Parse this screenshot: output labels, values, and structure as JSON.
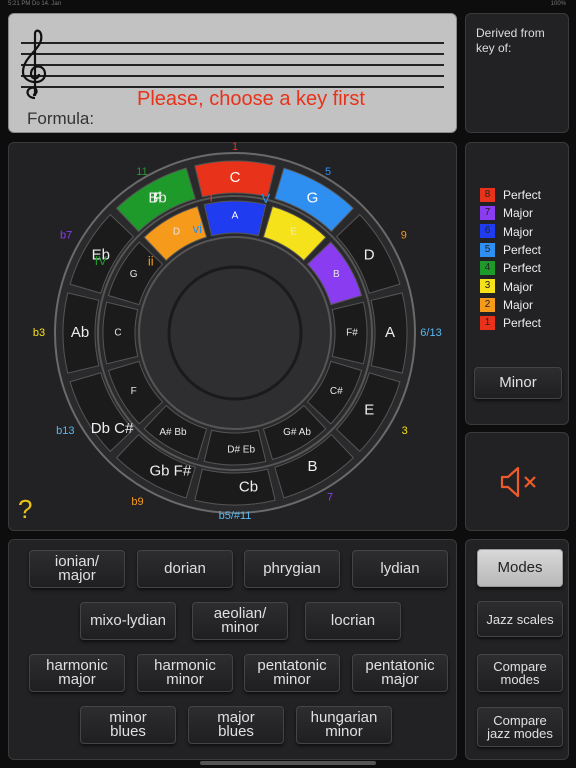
{
  "status": {
    "time": "5:21 PM  Do 14. Jan",
    "battery": "100%"
  },
  "staff": {
    "formula_label": "Formula:",
    "prompt": "Please, choose a key first"
  },
  "derived": {
    "label": "Derived from key of:"
  },
  "wheel": {
    "outer_keys": [
      "C",
      "G",
      "D",
      "A",
      "E",
      "B",
      "Cb",
      "Gb F#",
      "Db C#",
      "Ab",
      "Eb",
      "Bb",
      "F"
    ],
    "inner_keys": [
      "A",
      "E",
      "B",
      "F#",
      "C#",
      "G# Ab",
      "D# Eb",
      "A# Bb",
      "F",
      "C",
      "G",
      "D"
    ],
    "roman": [
      "I",
      "V",
      "vii",
      "iii",
      "vi",
      "ii",
      "IV"
    ],
    "intervals": [
      "1",
      "5",
      "9",
      "6/13",
      "3",
      "7",
      "b5/#11",
      "b9",
      "b13",
      "b3",
      "b7",
      "11"
    ]
  },
  "legend": [
    {
      "num": "8",
      "label": "Perfect",
      "color": "#e8321a"
    },
    {
      "num": "7",
      "label": "Major",
      "color": "#8a3cf0"
    },
    {
      "num": "6",
      "label": "Major",
      "color": "#1f3cf0"
    },
    {
      "num": "5",
      "label": "Perfect",
      "color": "#2e8ff0"
    },
    {
      "num": "4",
      "label": "Perfect",
      "color": "#1e9a2a"
    },
    {
      "num": "3",
      "label": "Major",
      "color": "#f5e21a"
    },
    {
      "num": "2",
      "label": "Major",
      "color": "#f59a1a"
    },
    {
      "num": "1",
      "label": "Perfect",
      "color": "#e8321a"
    }
  ],
  "minor_button": "Minor",
  "sound_icon": "speaker-muted-icon",
  "help": "?",
  "scales": {
    "row1": [
      "ionian/\nmajor",
      "dorian",
      "phrygian",
      "lydian"
    ],
    "row2": [
      "mixo-lydian",
      "aeolian/\nminor",
      "locrian"
    ],
    "row3": [
      "harmonic\nmajor",
      "harmonic\nminor",
      "pentatonic\nminor",
      "pentatonic\nmajor"
    ],
    "row4": [
      "minor\nblues",
      "major\nblues",
      "hungarian\nminor"
    ]
  },
  "modes_menu": [
    "Modes",
    "Jazz scales",
    "Compare\nmodes",
    "Compare\njazz modes"
  ]
}
